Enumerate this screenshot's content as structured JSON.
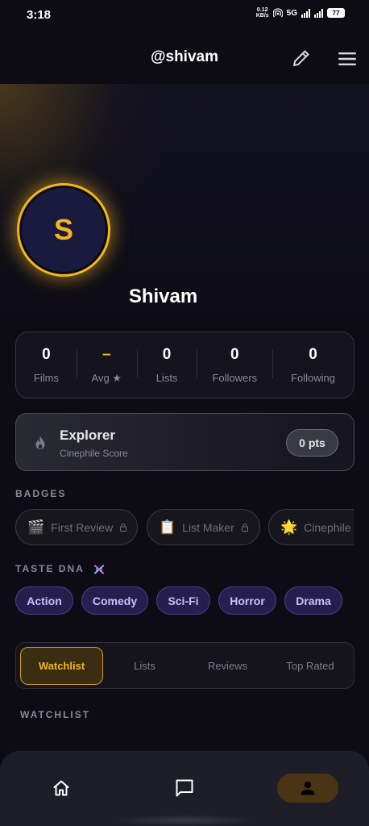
{
  "status_bar": {
    "time": "3:18",
    "net_speed_value": "0.12",
    "net_speed_unit": "KB/s",
    "network": "5G",
    "battery": "77"
  },
  "header": {
    "title": "@shivam",
    "edit_icon": "pencil-icon",
    "menu_icon": "hamburger-menu-icon"
  },
  "profile": {
    "avatar_letter": "S",
    "name": "Shivam",
    "accent_color": "#f3b51c"
  },
  "stats": [
    {
      "value": "0",
      "label": "Films"
    },
    {
      "value": "–",
      "label": "Avg ★"
    },
    {
      "value": "0",
      "label": "Lists"
    },
    {
      "value": "0",
      "label": "Followers"
    },
    {
      "value": "0",
      "label": "Following"
    }
  ],
  "score_card": {
    "icon": "flame-icon",
    "title": "Explorer",
    "subtitle": "Cinephile Score",
    "points": "0 pts"
  },
  "badges": {
    "heading": "BADGES",
    "items": [
      {
        "emoji": "🎬",
        "label": "First Review",
        "locked": true
      },
      {
        "emoji": "📋",
        "label": "List Maker",
        "locked": true
      },
      {
        "emoji": "🌟",
        "label": "Cinephile",
        "locked": true
      }
    ]
  },
  "taste_dna": {
    "heading": "TASTE DNA",
    "icon": "dna-icon",
    "genres": [
      "Action",
      "Comedy",
      "Sci-Fi",
      "Horror",
      "Drama"
    ]
  },
  "tabs": {
    "items": [
      "Watchlist",
      "Lists",
      "Reviews",
      "Top Rated"
    ],
    "active": "Watchlist"
  },
  "watchlist": {
    "heading": "WATCHLIST"
  },
  "bottom_nav": {
    "items": [
      {
        "icon": "home-icon"
      },
      {
        "icon": "chat-icon"
      },
      {
        "icon": "profile-icon",
        "active": true
      }
    ]
  }
}
